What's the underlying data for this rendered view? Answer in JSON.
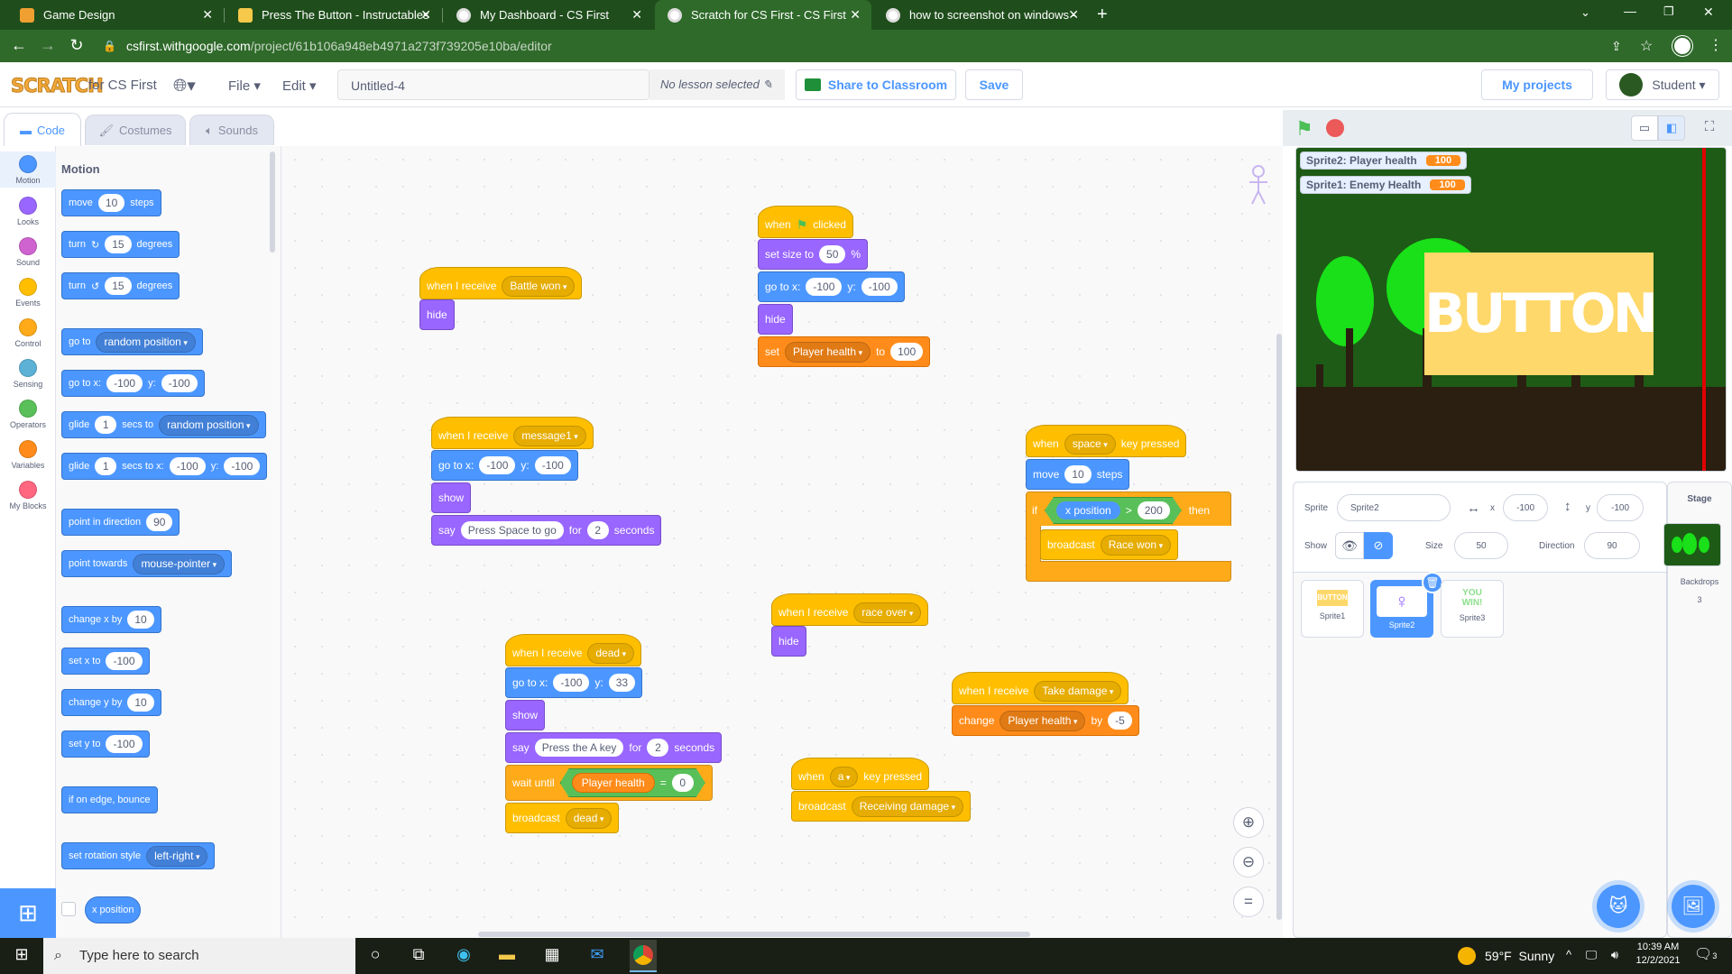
{
  "browser": {
    "tabs": [
      {
        "title": "Game Design"
      },
      {
        "title": "Press The Button - Instructables"
      },
      {
        "title": "My Dashboard - CS First"
      },
      {
        "title": "Scratch for CS First - CS First"
      },
      {
        "title": "how to screenshot on windows -"
      }
    ],
    "url_host": "csfirst.withgoogle.com",
    "url_path": "/project/61b106a948eb4971a273f739205e10ba/editor"
  },
  "menubar": {
    "logo": "SCRATCH",
    "for_label": "for CS First",
    "file": "File",
    "edit": "Edit",
    "project_title": "Untitled-4",
    "lesson": "No lesson selected",
    "share": "Share to Classroom",
    "save": "Save",
    "my_projects": "My projects",
    "user": "Student"
  },
  "editor_tabs": {
    "code": "Code",
    "costumes": "Costumes",
    "sounds": "Sounds"
  },
  "categories": [
    {
      "label": "Motion",
      "color": "#4c97ff"
    },
    {
      "label": "Looks",
      "color": "#9966ff"
    },
    {
      "label": "Sound",
      "color": "#cf63cf"
    },
    {
      "label": "Events",
      "color": "#ffbf00"
    },
    {
      "label": "Control",
      "color": "#ffab19"
    },
    {
      "label": "Sensing",
      "color": "#5cb1d6"
    },
    {
      "label": "Operators",
      "color": "#59c059"
    },
    {
      "label": "Variables",
      "color": "#ff8c1a"
    },
    {
      "label": "My Blocks",
      "color": "#ff6680"
    }
  ],
  "palette": {
    "heading": "Motion",
    "move": "move",
    "move_val": "10",
    "steps": "steps",
    "turn": "turn",
    "turn_val": "15",
    "degrees": "degrees",
    "goto": "go to",
    "random_position": "random position",
    "gotoxy": "go to x:",
    "x_val": "-100",
    "y_lbl": "y:",
    "y_val": "-100",
    "glide": "glide",
    "glide_val": "1",
    "secs_to": "secs to",
    "secs_to_x": "secs to x:",
    "point_dir": "point in direction",
    "dir_val": "90",
    "point_towards": "point towards",
    "mouse_pointer": "mouse-pointer",
    "change_x": "change x by",
    "change_x_val": "10",
    "set_x": "set x to",
    "set_x_val": "-100",
    "change_y": "change y by",
    "change_y_val": "10",
    "set_y": "set y to",
    "set_y_val": "-100",
    "bounce": "if on edge, bounce",
    "rotation": "set rotation style",
    "left_right": "left-right",
    "x_position": "x position"
  },
  "scripts": {
    "s1": {
      "hat": "when I receive",
      "msg": "Battle won",
      "b1": "hide"
    },
    "s2": {
      "when": "when",
      "clicked": "clicked",
      "set_size": "set size to",
      "size_val": "50",
      "pct": "%",
      "gotox": "go to x:",
      "x": "-100",
      "ylbl": "y:",
      "y": "-100",
      "hide": "hide",
      "set": "set",
      "var": "Player health",
      "to": "to",
      "val": "100"
    },
    "s3": {
      "hat": "when I receive",
      "msg": "message1",
      "gotox": "go to x:",
      "x": "-100",
      "ylbl": "y:",
      "y": "-100",
      "show": "show",
      "say": "say",
      "text": "Press Space to go",
      "for": "for",
      "secs": "2",
      "seconds": "seconds"
    },
    "s4": {
      "when": "when",
      "key": "space",
      "key_pressed": "key pressed",
      "move": "move",
      "steps_val": "10",
      "steps": "steps",
      "if": "if",
      "xpos": "x position",
      "gt": ">",
      "cmp": "200",
      "then": "then",
      "broadcast": "broadcast",
      "msg": "Race won"
    },
    "s5": {
      "hat": "when I receive",
      "msg": "race over",
      "b1": "hide"
    },
    "s6": {
      "hat": "when I receive",
      "msg": "dead",
      "gotox": "go to x:",
      "x": "-100",
      "ylbl": "y:",
      "y": "33",
      "show": "show",
      "say": "say",
      "text": "Press the A key",
      "for": "for",
      "secs": "2",
      "seconds": "seconds",
      "wait": "wait until",
      "var": "Player health",
      "eq": "=",
      "zero": "0",
      "broadcast": "broadcast"
    },
    "s7": {
      "hat": "when I receive",
      "msg": "Take damage",
      "change": "change",
      "var": "Player health",
      "by": "by",
      "val": "-5"
    },
    "s8": {
      "when": "when",
      "key": "a",
      "key_pressed": "key pressed",
      "broadcast": "broadcast",
      "msg": "Receiving damage"
    }
  },
  "stage": {
    "monitors": [
      {
        "label": "Sprite2: Player health",
        "value": "100"
      },
      {
        "label": "Sprite1: Enemy Health",
        "value": "100"
      }
    ],
    "button_text": "BUTTON"
  },
  "sprite_info": {
    "sprite_lbl": "Sprite",
    "sprite_name": "Sprite2",
    "x_lbl": "x",
    "x_val": "-100",
    "y_lbl": "y",
    "y_val": "-100",
    "show_lbl": "Show",
    "size_lbl": "Size",
    "size_val": "50",
    "dir_lbl": "Direction",
    "dir_val": "90"
  },
  "sprites": [
    {
      "name": "Sprite1",
      "thumb": "BUTTON"
    },
    {
      "name": "Sprite2"
    },
    {
      "name": "Sprite3",
      "thumb": "YOU WIN!"
    }
  ],
  "stage_panel": {
    "title": "Stage",
    "backdrops": "Backdrops",
    "backdrops_count": "3"
  },
  "taskbar": {
    "search": "Type here to search",
    "temp": "59°F",
    "weather": "Sunny",
    "time": "10:39 AM",
    "date": "12/2/2021",
    "notif": "3"
  }
}
